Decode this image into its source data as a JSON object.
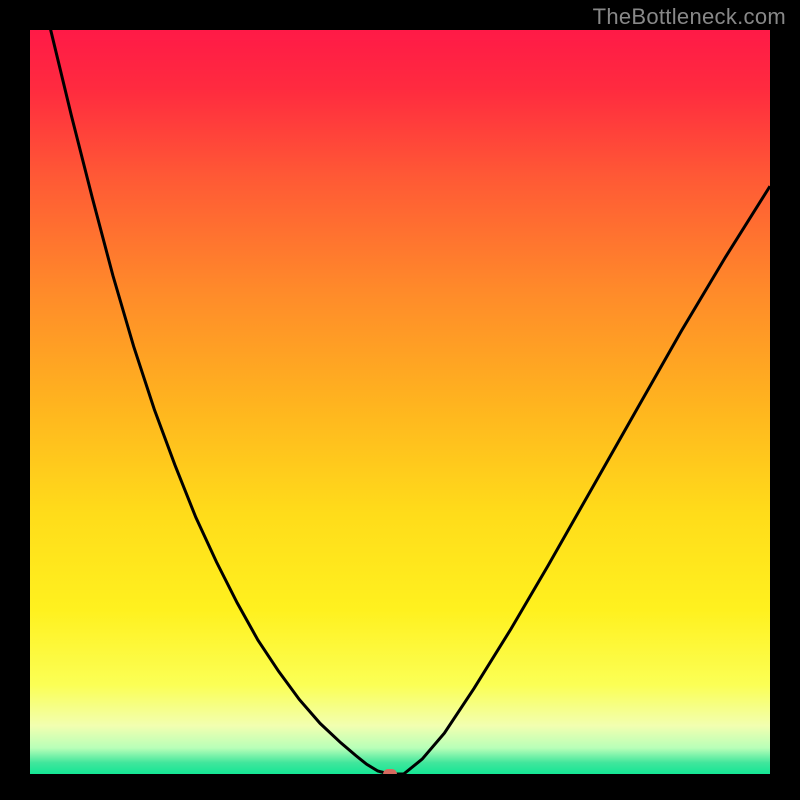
{
  "watermark": "TheBottleneck.com",
  "colors": {
    "curve": "#000000",
    "marker": "#d66a5f",
    "axis_black": "#000000",
    "gradient_stops": [
      {
        "offset": 0.0,
        "color": "#ff1a47"
      },
      {
        "offset": 0.08,
        "color": "#ff2b3f"
      },
      {
        "offset": 0.2,
        "color": "#ff5a35"
      },
      {
        "offset": 0.35,
        "color": "#ff8a2a"
      },
      {
        "offset": 0.5,
        "color": "#ffb31f"
      },
      {
        "offset": 0.65,
        "color": "#ffdc1a"
      },
      {
        "offset": 0.78,
        "color": "#fff11f"
      },
      {
        "offset": 0.88,
        "color": "#fbff55"
      },
      {
        "offset": 0.935,
        "color": "#f2ffb0"
      },
      {
        "offset": 0.965,
        "color": "#b8ffb8"
      },
      {
        "offset": 0.985,
        "color": "#40e69c"
      },
      {
        "offset": 1.0,
        "color": "#14e695"
      }
    ]
  },
  "chart_data": {
    "type": "line",
    "title": "",
    "xlabel": "",
    "ylabel": "",
    "xlim": [
      0,
      1
    ],
    "ylim": [
      0,
      1
    ],
    "grid": false,
    "legend": false,
    "description": "V-shaped bottleneck curve over vertical rainbow heat gradient (red top, green bottom). Curve reaches minimum near x≈0.48.",
    "series": [
      {
        "name": "bottleneck-curve",
        "x": [
          0.0,
          0.028,
          0.056,
          0.084,
          0.112,
          0.14,
          0.168,
          0.196,
          0.224,
          0.252,
          0.28,
          0.308,
          0.336,
          0.364,
          0.392,
          0.42,
          0.44,
          0.455,
          0.47,
          0.485,
          0.505,
          0.53,
          0.56,
          0.6,
          0.65,
          0.7,
          0.76,
          0.82,
          0.88,
          0.94,
          1.0
        ],
        "y": [
          1.13,
          1.0,
          0.885,
          0.775,
          0.67,
          0.575,
          0.49,
          0.415,
          0.345,
          0.285,
          0.23,
          0.18,
          0.138,
          0.1,
          0.068,
          0.042,
          0.025,
          0.013,
          0.004,
          0.0,
          0.0,
          0.02,
          0.055,
          0.115,
          0.195,
          0.28,
          0.385,
          0.49,
          0.595,
          0.695,
          0.79
        ]
      }
    ],
    "marker": {
      "x": 0.487,
      "y": 0.0
    }
  }
}
